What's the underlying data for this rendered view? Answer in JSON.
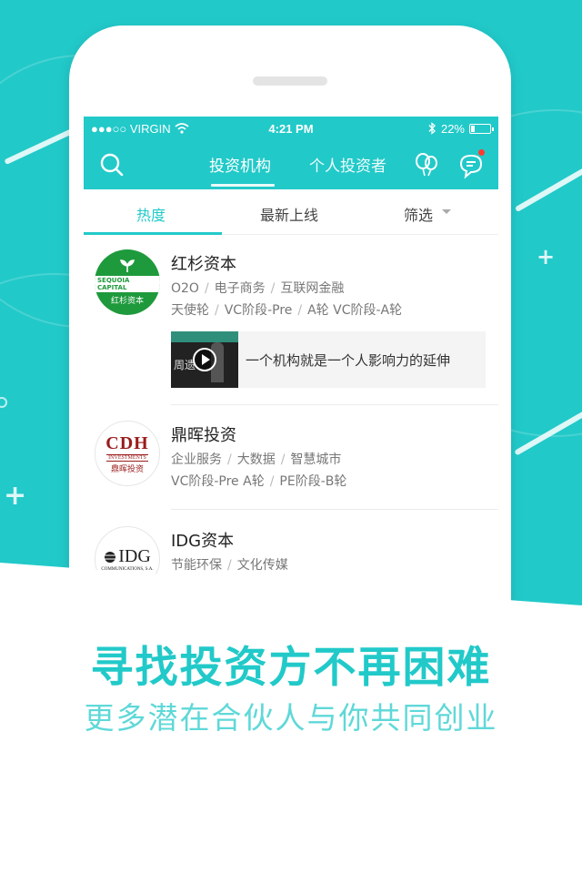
{
  "status_bar": {
    "carrier": "●●●○○ VIRGIN",
    "time": "4:21 PM",
    "battery": "22%",
    "battery_level": 0.22
  },
  "nav": {
    "tab_active": "投资机构",
    "tab_second": "个人投资者",
    "icons": [
      "search-icon",
      "balloon-icon",
      "chat-icon"
    ]
  },
  "subtabs": {
    "hot": "热度",
    "newest": "最新上线",
    "filter": "筛选"
  },
  "list": [
    {
      "name": "红杉资本",
      "logo_line1": "SEQUOIA CAPITAL",
      "logo_line2": "红杉资本",
      "tags1": [
        "O2O",
        "电子商务",
        "互联网金融"
      ],
      "tags2": [
        "天使轮",
        "VC阶段-Pre",
        "A轮 VC阶段-A轮"
      ],
      "video": {
        "title": "一个机构就是一个人影响力的延伸",
        "thumb_text": "周遗"
      }
    },
    {
      "name": "鼎晖投资",
      "logo_line1": "CDH",
      "logo_line2": "INVESTMENTS",
      "logo_line3": "鼎晖投资",
      "tags1": [
        "企业服务",
        "大数据",
        "智慧城市"
      ],
      "tags2": [
        "VC阶段-Pre A轮",
        "PE阶段-B轮"
      ]
    },
    {
      "name": "IDG资本",
      "logo_line1": "IDG",
      "logo_line2": "COMMUNICATIONS, S.A.",
      "tags1": [
        "节能环保",
        "文化传媒"
      ]
    }
  ],
  "promo": {
    "headline": "寻找投资方不再困难",
    "subline": "更多潜在合伙人与你共同创业"
  },
  "colors": {
    "accent": "#22c9c9",
    "sequoia_green": "#1e9a3c",
    "gdh_red": "#9b1c1c"
  }
}
